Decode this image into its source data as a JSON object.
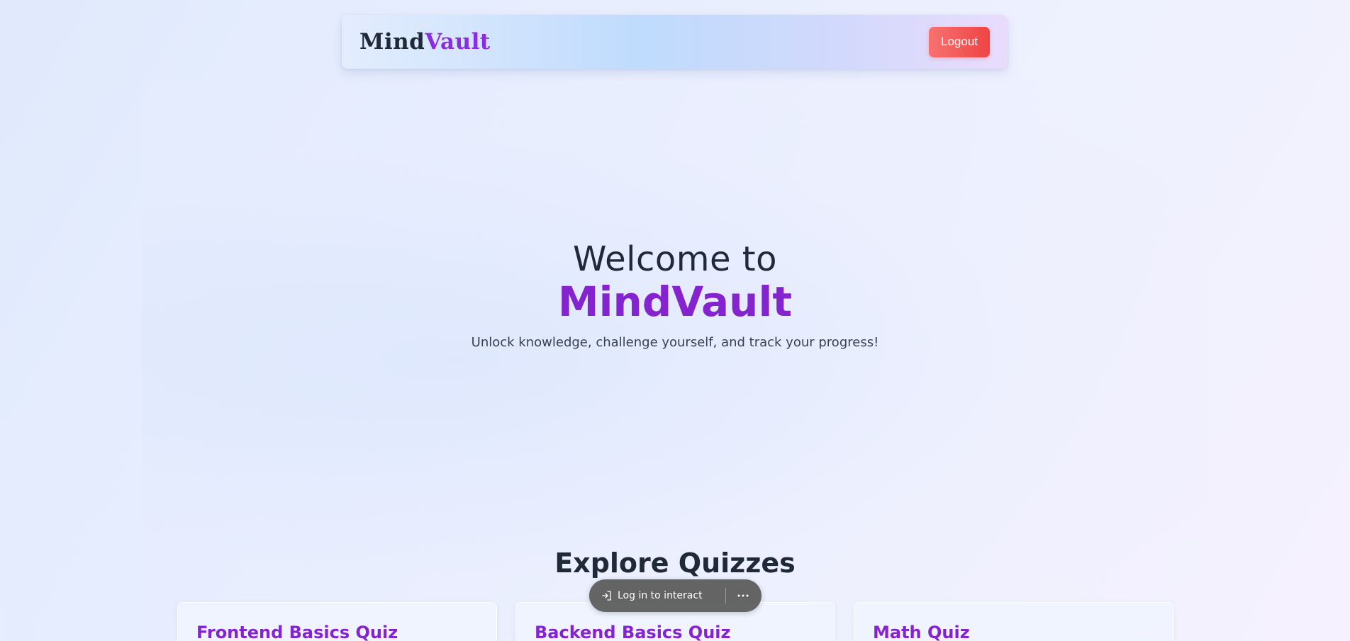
{
  "navbar": {
    "logo_part1": "Mind",
    "logo_part2": "Vault",
    "logout_label": "Logout"
  },
  "hero": {
    "line1": "Welcome to",
    "line2": "MindVault",
    "subtitle": "Unlock knowledge, challenge yourself, and track your progress!"
  },
  "quizzes": {
    "section_title": "Explore Quizzes",
    "cards": [
      {
        "title": "Frontend Basics Quiz"
      },
      {
        "title": "Backend Basics Quiz"
      },
      {
        "title": "Math Quiz"
      }
    ]
  },
  "overlay_toolbar": {
    "login_label": "Log in to interact",
    "login_icon": "login-arrow-icon",
    "more_icon": "more-horizontal-icon"
  },
  "colors": {
    "accent_purple": "#8524cf",
    "logout_red": "#ef4444",
    "text_dark": "#1f2937"
  }
}
